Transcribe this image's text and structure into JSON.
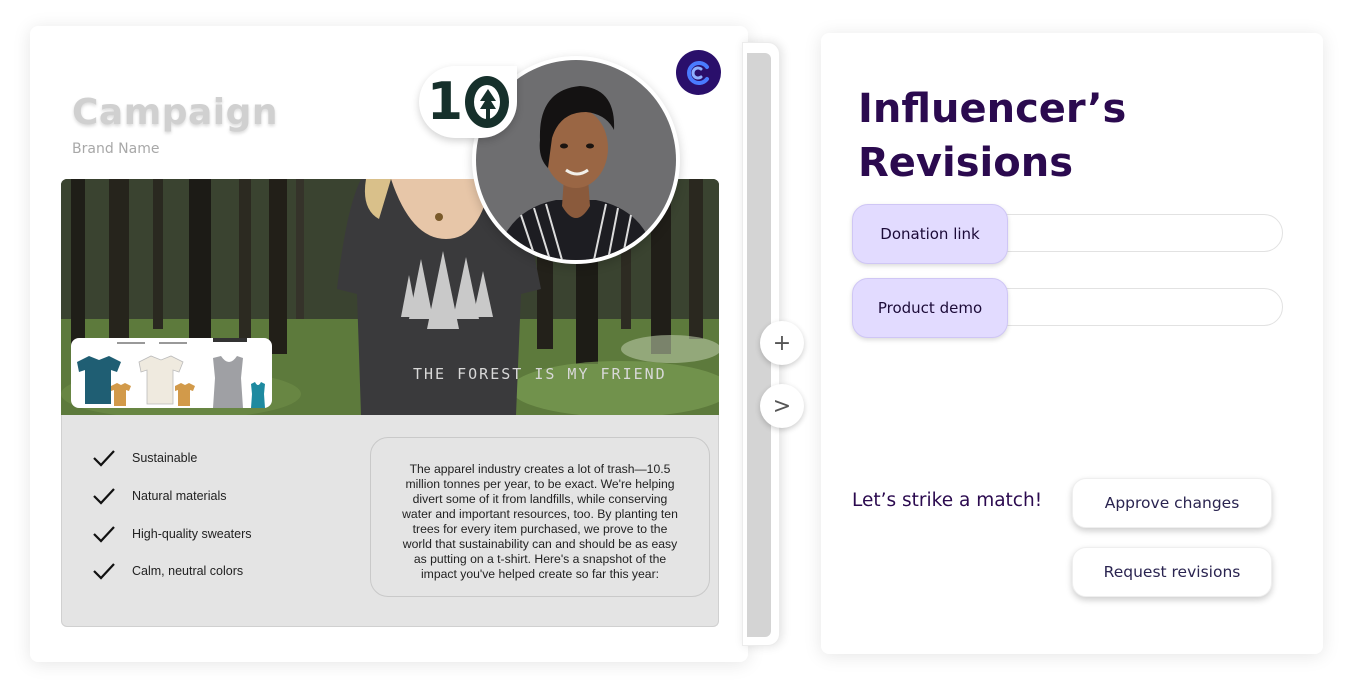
{
  "campaign": {
    "title": "Campaign",
    "brand_name": "Brand Name",
    "logo_text": "10",
    "shirt_text": "THE FOREST IS MY FRIEND",
    "features": [
      "Sustainable",
      "Natural materials",
      "High-quality sweaters",
      "Calm, neutral colors"
    ],
    "description": "The apparel industry creates a lot of trash—10.5 million tonnes per year, to be exact. We're helping divert some of it from landfills, while conserving water and important resources, too. By planting ten trees for every item purchased, we prove to the world that sustainability can and should be as easy as putting on a t-shirt. Here's a snapshot of the impact you've helped create so far this year:"
  },
  "side_buttons": {
    "add": "+",
    "next": ">"
  },
  "revisions": {
    "title": "Influencer’s Revisions",
    "items": [
      {
        "label": "Donation link"
      },
      {
        "label": "Product demo"
      }
    ],
    "match_text": "Let’s strike a match!",
    "approve_label": "Approve changes",
    "request_label": "Request revisions"
  },
  "colors": {
    "brand_dark": "#2b0a4f",
    "chip_bg": "#e2dbff",
    "app_badge": "#2a0f6b",
    "app_badge_accent": "#4a7bff"
  },
  "icons": [
    "check-icon",
    "plus-icon",
    "chevron-right-icon",
    "app-logo-icon",
    "brand-logo-icon"
  ]
}
